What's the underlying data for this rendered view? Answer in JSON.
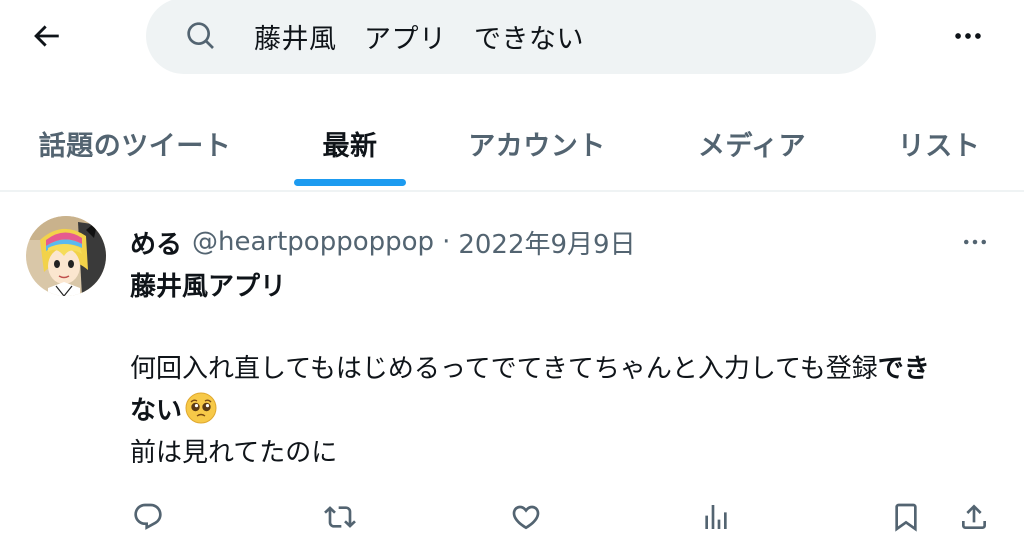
{
  "header": {
    "back_icon": "arrow-left-icon",
    "search": {
      "icon": "search-icon",
      "query": "藤井風　アプリ　できない"
    },
    "more_icon": "more-horizontal-icon"
  },
  "tabs": [
    {
      "label": "話題のツイート",
      "active": false
    },
    {
      "label": "最新",
      "active": true
    },
    {
      "label": "アカウント",
      "active": false
    },
    {
      "label": "メディア",
      "active": false
    },
    {
      "label": "リスト",
      "active": false
    }
  ],
  "tweet": {
    "display_name": "める",
    "handle": "@heartpoppoppop",
    "separator": "·",
    "date": "2022年9月9日",
    "title": "藤井風アプリ",
    "line1_normal": "何回入れ直してもはじめるってでてきてちゃんと入力しても登録",
    "line1_bold": "でき",
    "line2_bold": "ない",
    "emoji": "pleading-face-emoji",
    "line3": "前は見れてたのに"
  },
  "actions": [
    {
      "icon": "reply-icon"
    },
    {
      "icon": "retweet-icon"
    },
    {
      "icon": "like-icon"
    },
    {
      "icon": "analytics-icon"
    },
    {
      "icon": "bookmark-icon"
    },
    {
      "icon": "share-icon"
    }
  ],
  "colors": {
    "accent": "#1d9bf0",
    "text_primary": "#0f1419",
    "text_secondary": "#536471",
    "search_bg": "#eff3f4"
  }
}
